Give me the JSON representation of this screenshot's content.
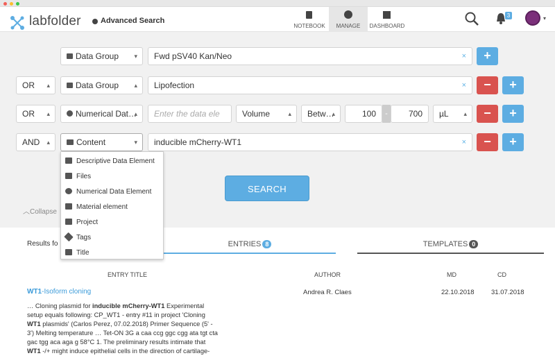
{
  "window": {
    "dots": [
      "#f25f58",
      "#fbbe2f",
      "#3bc84b"
    ]
  },
  "header": {
    "logo": "labfolder",
    "page_title": "Advanced Search",
    "nav": [
      {
        "label": "NOTEBOOK"
      },
      {
        "label": "MANAGE"
      },
      {
        "label": "DASHBOARD"
      }
    ],
    "notification_count": "3"
  },
  "rows": [
    {
      "operator": "",
      "field_type": "Data Group",
      "value": "Fwd pSV40 Kan/Neo"
    },
    {
      "operator": "OR",
      "field_type": "Data Group",
      "value": "Lipofection"
    },
    {
      "operator": "OR",
      "field_type": "Numerical Dat…",
      "value_placeholder": "Enter the data ele",
      "quantity": "Volume",
      "range": "Betw…",
      "from": "100",
      "to": "700",
      "unit": "µL"
    },
    {
      "operator": "AND",
      "field_type": "Content",
      "value": "inducible mCherry-WT1"
    }
  ],
  "dropdown": {
    "items": [
      "Descriptive Data Element",
      "Files",
      "Numerical Data Element",
      "Material element",
      "Project",
      "Tags",
      "Title"
    ]
  },
  "search_button": "SEARCH",
  "collapse_label": "Collapse",
  "results": {
    "label": "Results fo",
    "tabs": [
      {
        "label": "ENTRIES",
        "count": "8"
      },
      {
        "label": "TEMPLATES",
        "count": "0"
      }
    ],
    "columns": {
      "title": "ENTRY TITLE",
      "author": "AUTHOR",
      "md": "MD",
      "cd": "CD"
    },
    "entries": [
      {
        "title_bold": "WT1",
        "title_rest": "-Isoform cloning",
        "author": "Andrea R. Claes",
        "md": "22.10.2018",
        "cd": "31.07.2018",
        "snippet": [
          "… Cloning plasmid for ",
          "inducible mCherry-WT1",
          " Experimental setup equals following: CP_WT1 - entry #11 in project 'Cloning ",
          "WT1",
          " plasmids' (Carlos Perez, 07.02.2018) Primer Sequence (5' - 3') Melting temperature … Tet-ON 3G a caa ccg ggc cgg ata tgt cta gac tgg aca aga g 58°C 1. The preliminary results intimate that ",
          "WT1",
          " -/+ might induce epithelial cells in the direction of cartilage-"
        ]
      }
    ]
  },
  "colors": {
    "accent": "#5dade2",
    "danger": "#d9534f",
    "background": "#f1f1f1"
  }
}
